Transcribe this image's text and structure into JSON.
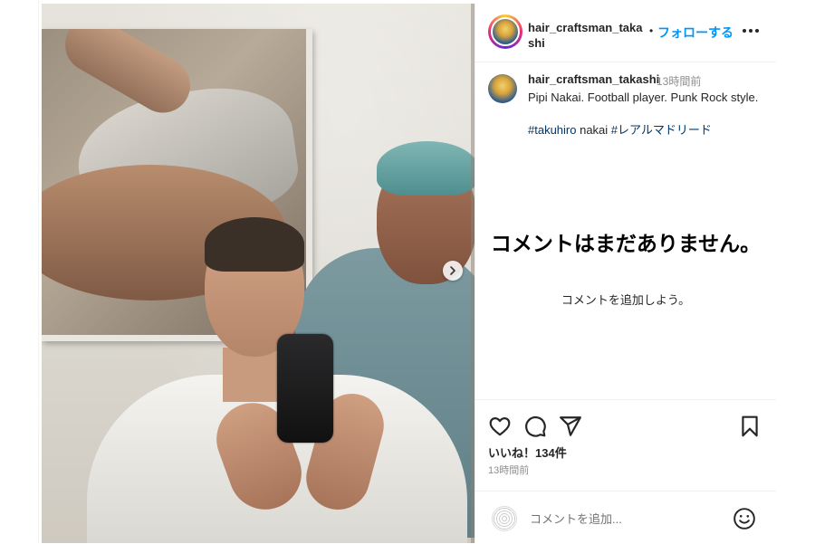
{
  "post": {
    "username": "hair_craftsman_takashi",
    "header_username_line1": "hair_craftsman_taka",
    "header_username_line2": "shi",
    "dot": "•",
    "follow_label": "フォローする",
    "time_ago": "13時間前",
    "caption_line": "Pipi Nakai. Football player. Punk Rock style.",
    "tag1": "#takuhiro",
    "tag_plain": " nakai ",
    "tag2": "#レアルマドリード",
    "empty_title": "コメントはまだありません。",
    "empty_sub": "コメントを追加しよう。",
    "likes": "いいね！134件",
    "post_time": "13時間前",
    "comment_placeholder": "コメントを追加..."
  },
  "icons": {
    "more": "more-icon",
    "heart": "heart-icon",
    "comment": "comment-icon",
    "share": "share-icon",
    "save": "bookmark-icon",
    "emoji": "emoji-icon",
    "next": "chevron-right-icon"
  },
  "colors": {
    "follow_blue": "#0095f6",
    "hashtag": "#00376b",
    "muted": "#8e8e8e"
  }
}
